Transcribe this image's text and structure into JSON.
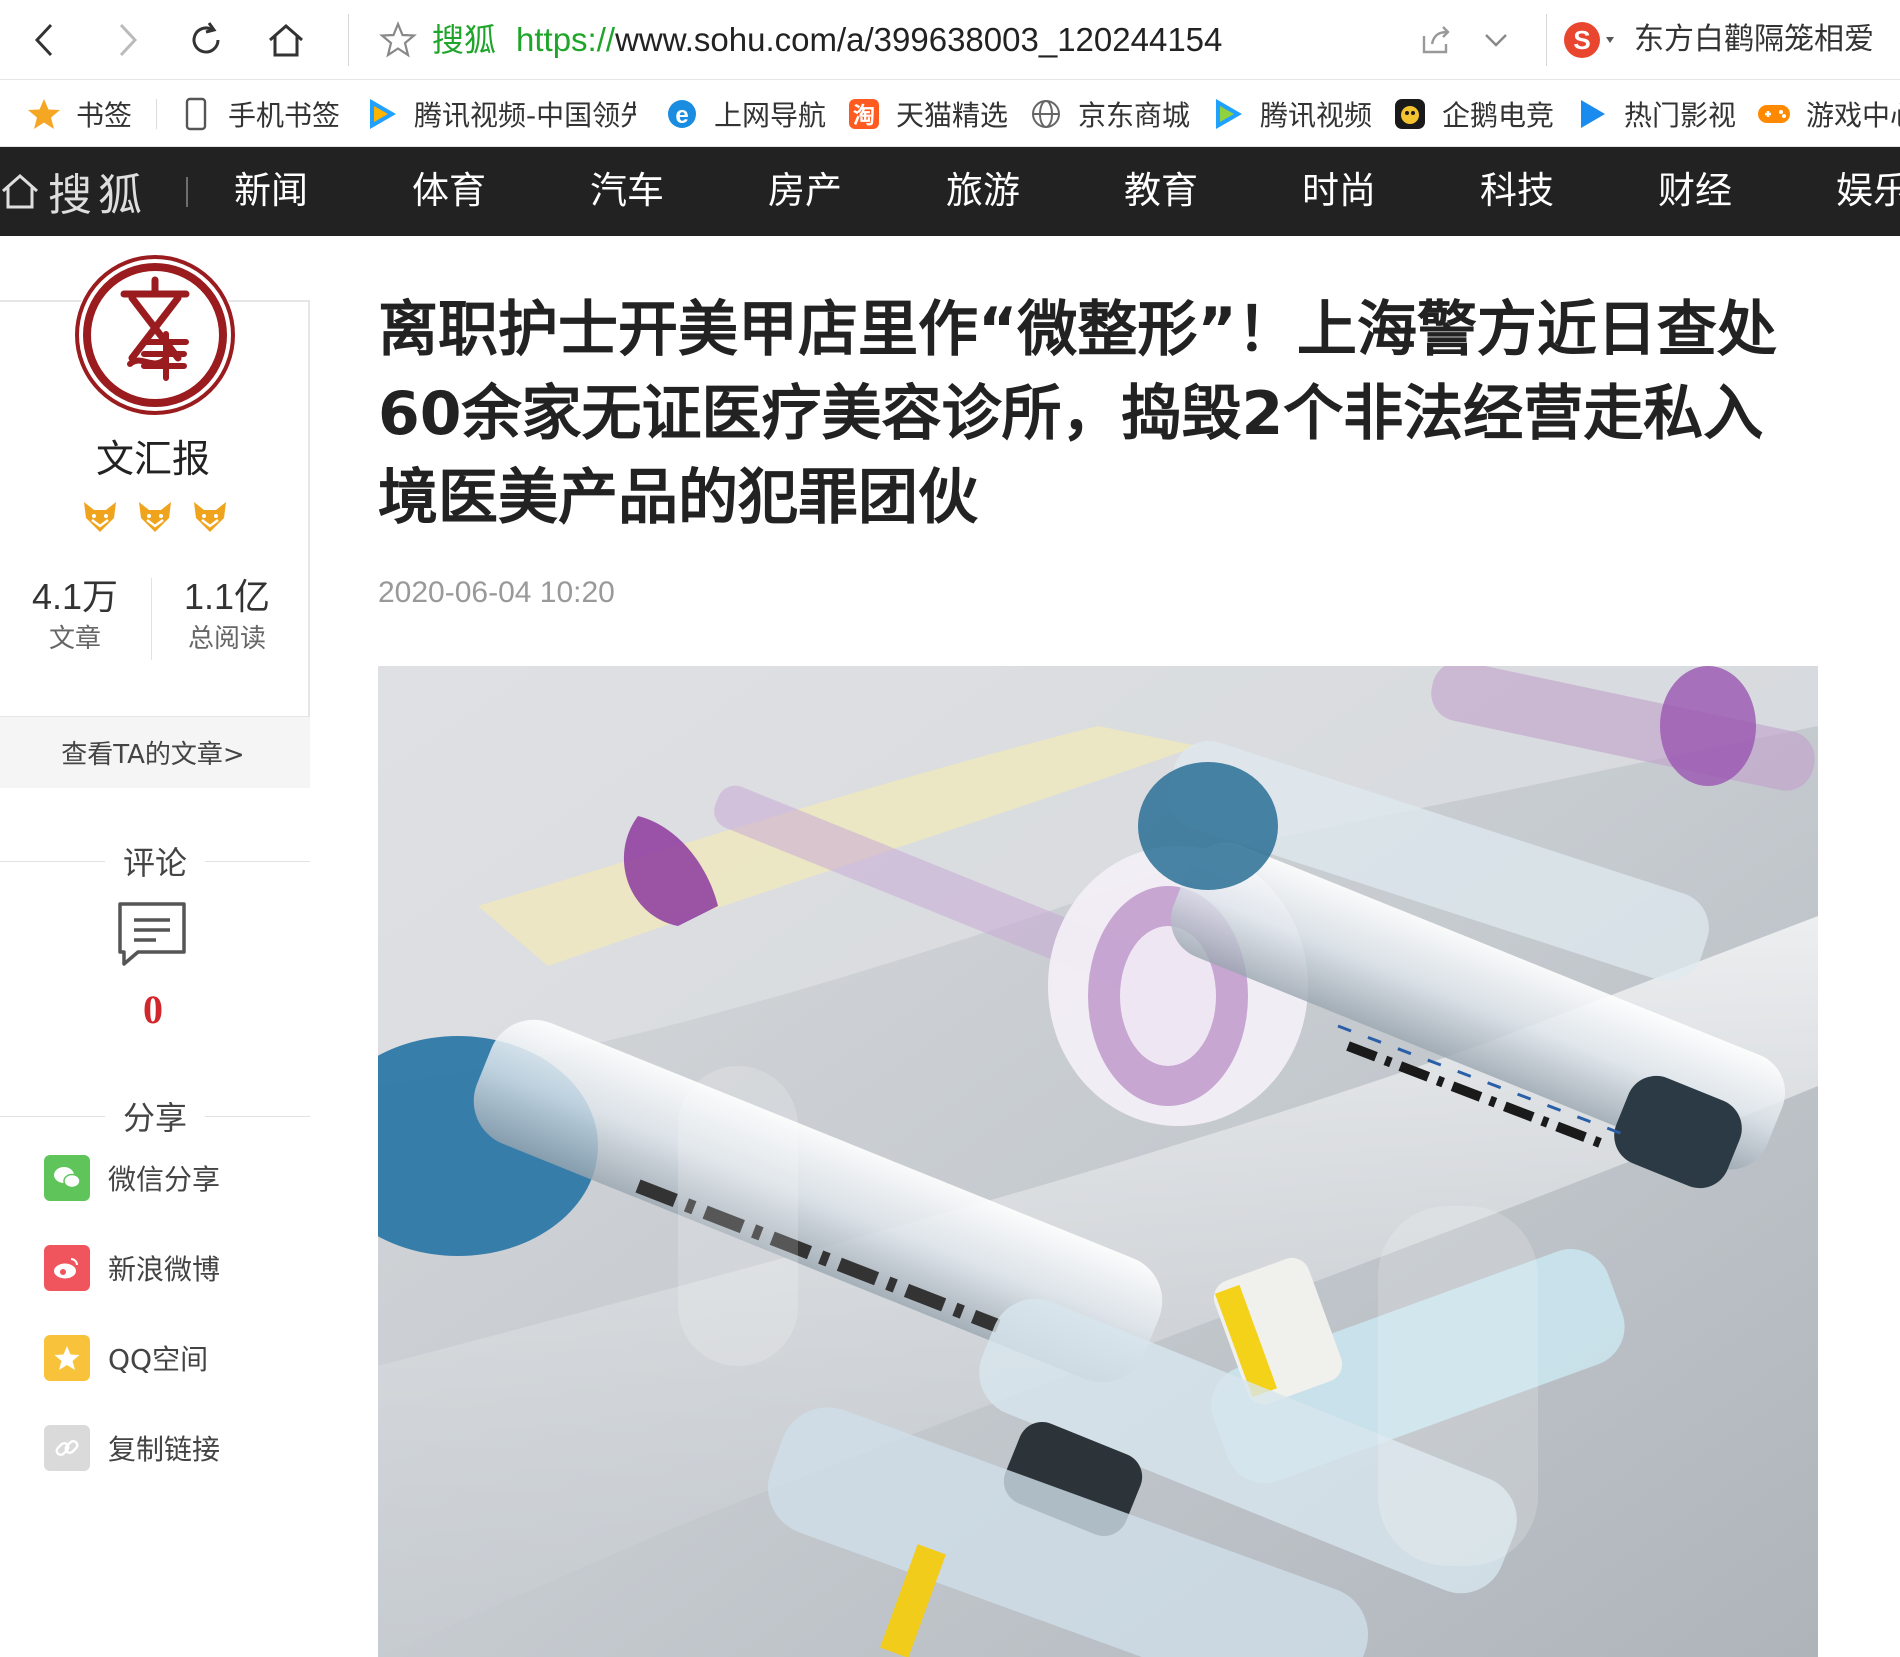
{
  "browser": {
    "site_name": "搜狐",
    "url_scheme": "https://",
    "url_rest": "www.sohu.com/a/399638003_120244154",
    "hot_search": "东方白鹳隔笼相爱"
  },
  "bookmarks": [
    {
      "label": "书签",
      "icon": "star-icon"
    },
    {
      "label": "手机书签",
      "icon": "phone-icon"
    },
    {
      "label": "腾讯视频-中国领先",
      "icon": "tencent-video-icon"
    },
    {
      "label": "上网导航",
      "icon": "ie-icon"
    },
    {
      "label": "天猫精选",
      "icon": "tmall-icon"
    },
    {
      "label": "京东商城",
      "icon": "globe-icon"
    },
    {
      "label": "腾讯视频",
      "icon": "tencent-video-icon"
    },
    {
      "label": "企鹅电竞",
      "icon": "penguin-icon"
    },
    {
      "label": "热门影视",
      "icon": "play-icon"
    },
    {
      "label": "游戏中心",
      "icon": "gamepad-icon"
    }
  ],
  "nav": {
    "logo": "搜狐",
    "items": [
      "新闻",
      "体育",
      "汽车",
      "房产",
      "旅游",
      "教育",
      "时尚",
      "科技",
      "财经",
      "娱乐"
    ]
  },
  "author": {
    "name": "文汇报",
    "articles_count": "4.1万",
    "articles_label": "文章",
    "reads_count": "1.1亿",
    "reads_label": "总阅读",
    "view_button": "查看TA的文章>"
  },
  "comments": {
    "title": "评论",
    "count": "0"
  },
  "share": {
    "title": "分享",
    "items": [
      {
        "label": "微信分享",
        "icon": "wechat-icon",
        "color": "#5fc55b"
      },
      {
        "label": "新浪微博",
        "icon": "weibo-icon",
        "color": "#f0545d"
      },
      {
        "label": "QQ空间",
        "icon": "qzone-icon",
        "color": "#f8c33a"
      },
      {
        "label": "复制链接",
        "icon": "link-icon",
        "color": "#dadada"
      }
    ]
  },
  "article": {
    "title": "离职护士开美甲店里作“微整形”！上海警方近日查处60余家无证医疗美容诊所，捣毁2个非法经营走私入境医美产品的犯罪团伙",
    "date": "2020-06-04 10:20"
  },
  "colors": {
    "nav_bg": "#222222",
    "accent_red": "#d0262c",
    "url_green": "#1fa52a"
  }
}
